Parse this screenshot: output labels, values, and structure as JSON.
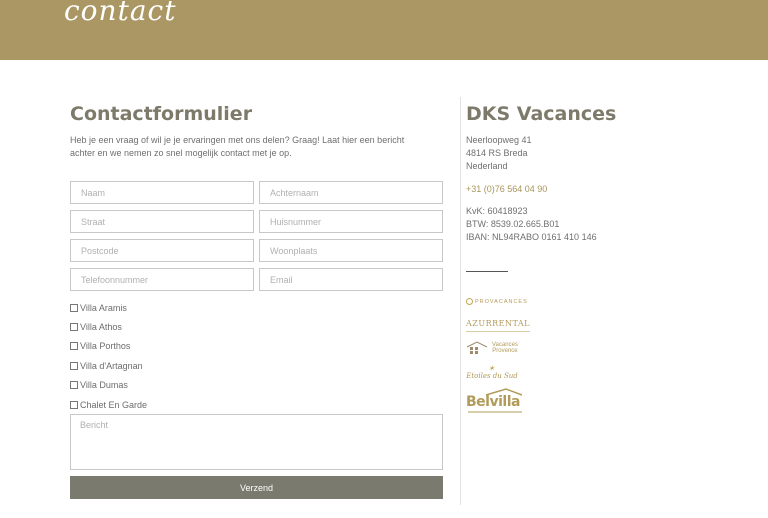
{
  "hero": {
    "script_title": "contact"
  },
  "form": {
    "title": "Contactformulier",
    "intro": "Heb je een vraag of wil je je ervaringen met ons delen? Graag! Laat hier een bericht achter en we nemen zo snel mogelijk contact met je op.",
    "fields": {
      "naam": "Naam",
      "achternaam": "Achternaam",
      "straat": "Straat",
      "huisnummer": "Huisnummer",
      "postcode": "Postcode",
      "woonplaats": "Woonplaats",
      "telefoon": "Telefoonnummer",
      "email": "Email"
    },
    "villas": [
      "Villa Aramis",
      "Villa Athos",
      "Villa Porthos",
      "Villa d'Artagnan",
      "Villa Dumas",
      "Chalet En Garde"
    ],
    "message_placeholder": "Bericht",
    "submit_label": "Verzend"
  },
  "company": {
    "name": "DKS Vacances",
    "address": [
      "Neerloopweg 41",
      "4814 RS Breda",
      "Nederland"
    ],
    "phone": "+31 (0)76 564 04 90",
    "legal": [
      "KvK: 60418923",
      "BTW: 8539.02.665.B01",
      "IBAN: NL94RABO 0161 410 146"
    ]
  },
  "partners": {
    "provacances": "PROVACANCES",
    "azurrental": "AZURRENTAL",
    "vacances_provence": [
      "Vacances",
      "Provence"
    ],
    "etoiles": "Etoiles du Sud",
    "belvilla": "Belvilla"
  },
  "colors": {
    "accent": "#ab9763",
    "button": "#7a7a6e",
    "heading": "#7d7a6a"
  }
}
